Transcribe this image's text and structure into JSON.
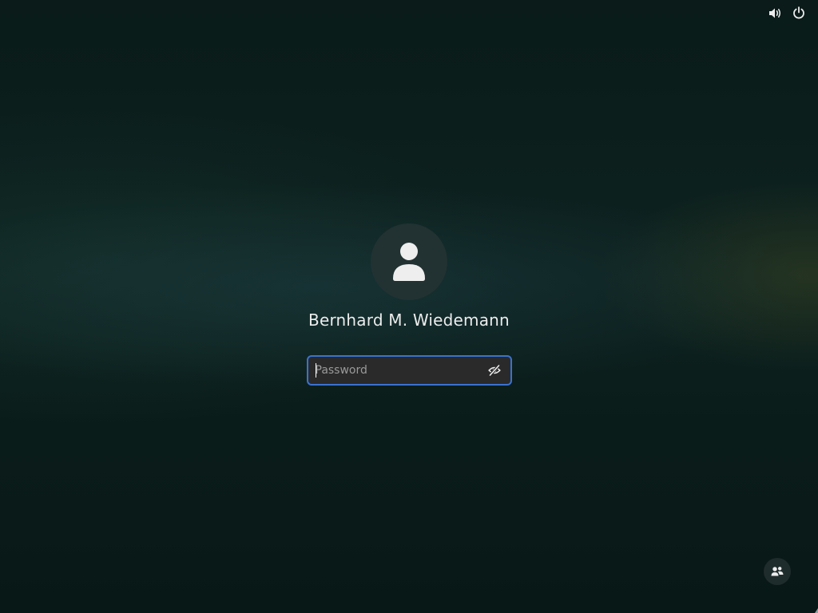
{
  "top_bar": {
    "icons": [
      "volume-icon",
      "power-icon"
    ]
  },
  "login": {
    "avatar_icon": "user-avatar-icon",
    "user_name": "Bernhard M. Wiedemann",
    "password": {
      "placeholder": "Password",
      "value": "",
      "reveal_icon": "eye-slash-icon"
    }
  },
  "bottom_bar": {
    "switch_user_icon": "users-icon"
  },
  "colors": {
    "focus_border": "#3b72d0",
    "field_background": "#2a2a2a",
    "avatar_background": "#223232",
    "text": "#ececec"
  }
}
